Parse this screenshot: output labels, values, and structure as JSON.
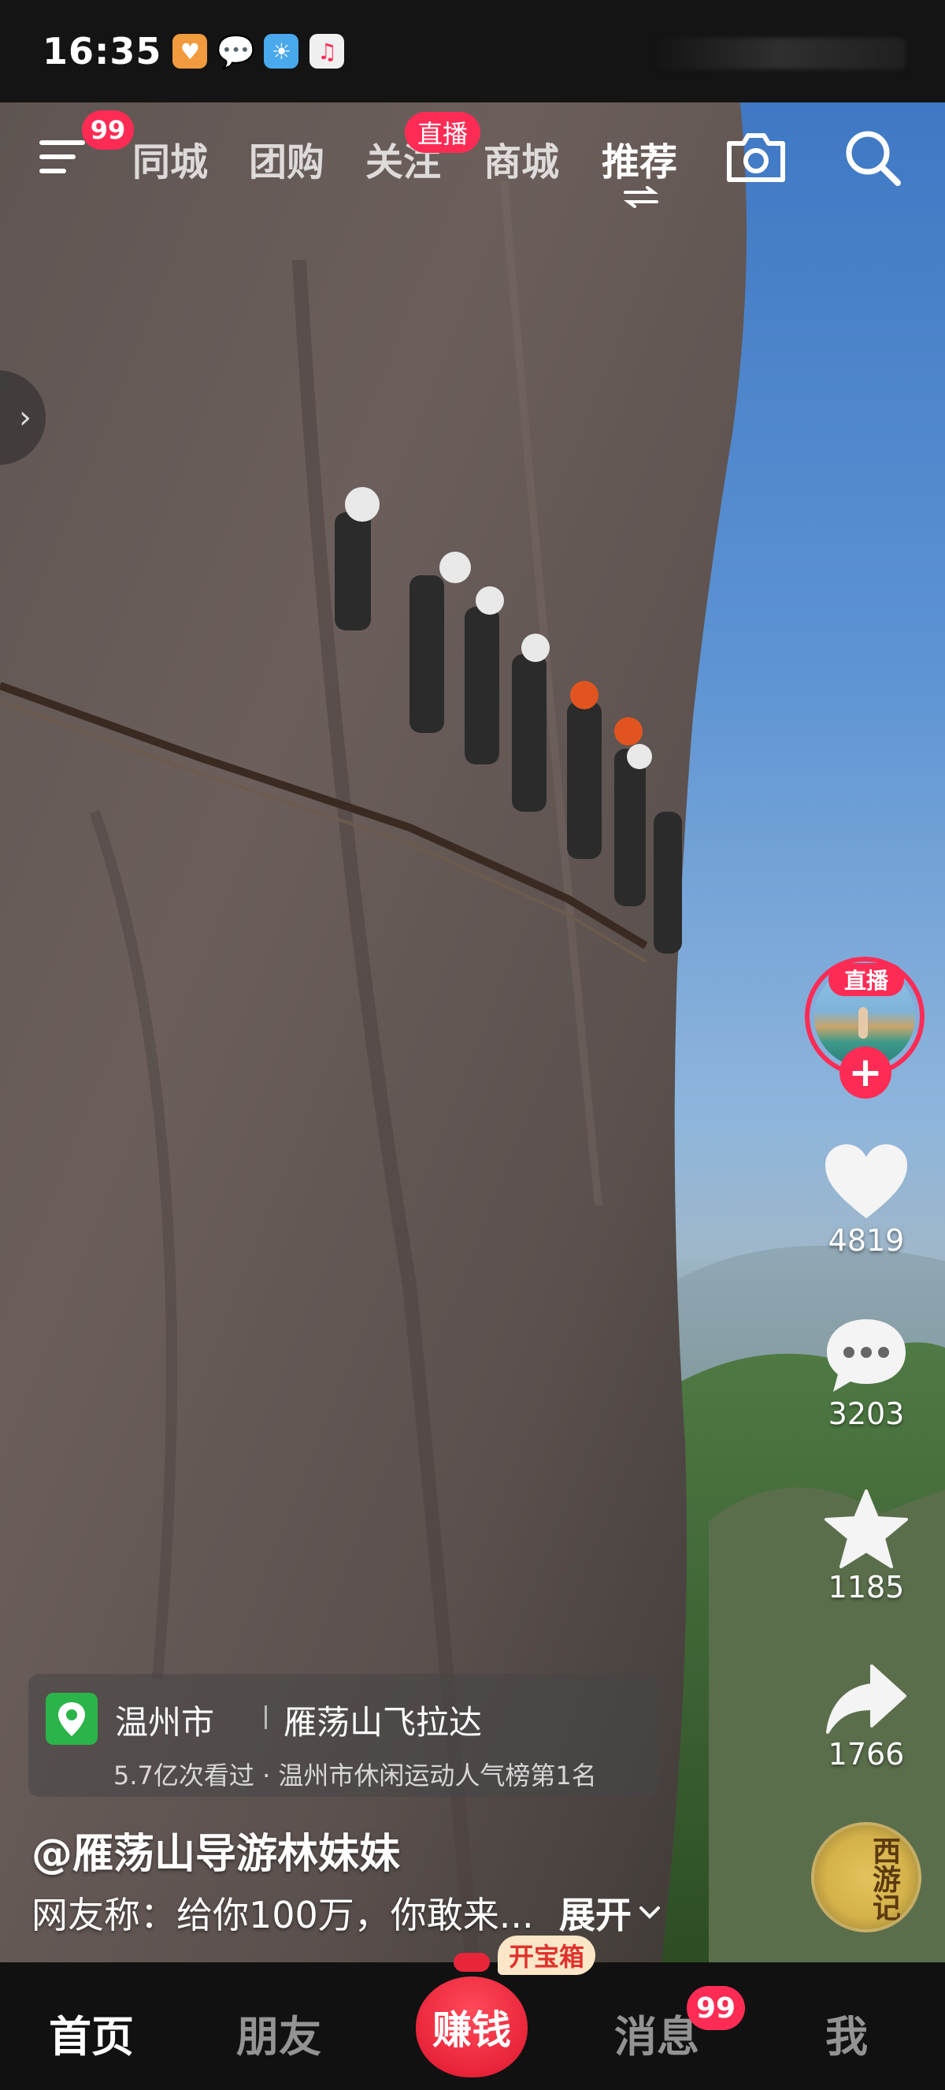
{
  "status_bar": {
    "time": "16:35",
    "icons": [
      "app-heart-icon",
      "wechat-icon",
      "weather-icon",
      "music-icon"
    ]
  },
  "top_nav": {
    "menu_badge": "99",
    "tabs": [
      {
        "label": "同城",
        "active": false
      },
      {
        "label": "团购",
        "active": false
      },
      {
        "label": "关注",
        "active": false
      },
      {
        "label": "商城",
        "active": false
      },
      {
        "label": "推荐",
        "active": true
      }
    ],
    "follow_live_badge": "直播"
  },
  "rail": {
    "avatar_live_label": "直播",
    "follow_symbol": "+",
    "like_count": "4819",
    "comment_count": "3203",
    "favorite_count": "1185",
    "share_count": "1766",
    "disc_text": "西游记"
  },
  "location": {
    "city": "温州市",
    "spot": "雁荡山飞拉达",
    "subtitle": "5.7亿次看过 · 温州市休闲运动人气榜第1名"
  },
  "video": {
    "author": "@雁荡山导游林妹妹",
    "caption": "网友称：给你100万，你敢来...",
    "expand_label": "展开"
  },
  "bottom_nav": {
    "items": [
      {
        "label": "首页",
        "active": true
      },
      {
        "label": "朋友",
        "active": false
      },
      {
        "label": "赚钱",
        "active": false
      },
      {
        "label": "消息",
        "active": false
      },
      {
        "label": "我",
        "active": false
      }
    ],
    "treasure_label": "开宝箱",
    "message_badge": "99"
  },
  "colors": {
    "accent": "#fe2c55",
    "location_pin": "#2bb44a"
  }
}
